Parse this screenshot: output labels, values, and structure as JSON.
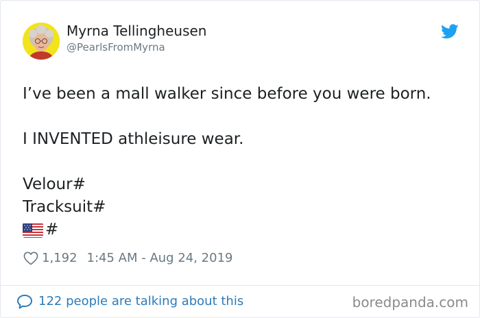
{
  "author": {
    "display_name": "Myrna Tellingheusen",
    "handle": "@PearlsFromMyrna"
  },
  "tweet": {
    "lines": [
      "I’ve been a mall walker since before you were born.",
      "I INVENTED athleisure wear.",
      "Velour#",
      "Tracksuit#",
      "#"
    ]
  },
  "meta": {
    "like_count": "1,192",
    "timestamp": "1:45 AM - Aug 24, 2019"
  },
  "footer": {
    "talking_text": "122 people are talking about this"
  },
  "watermark": "boredpanda.com",
  "icons": {
    "brand": "twitter-bird-icon",
    "like": "heart-icon",
    "reply": "speech-bubble-icon",
    "flag": "us-flag-icon"
  },
  "colors": {
    "twitter_blue": "#1da1f2",
    "link_blue": "#2b7bb9",
    "text": "#1c2022",
    "muted": "#697882",
    "border": "#e1e8ed",
    "avatar_bg": "#f2e31a"
  }
}
